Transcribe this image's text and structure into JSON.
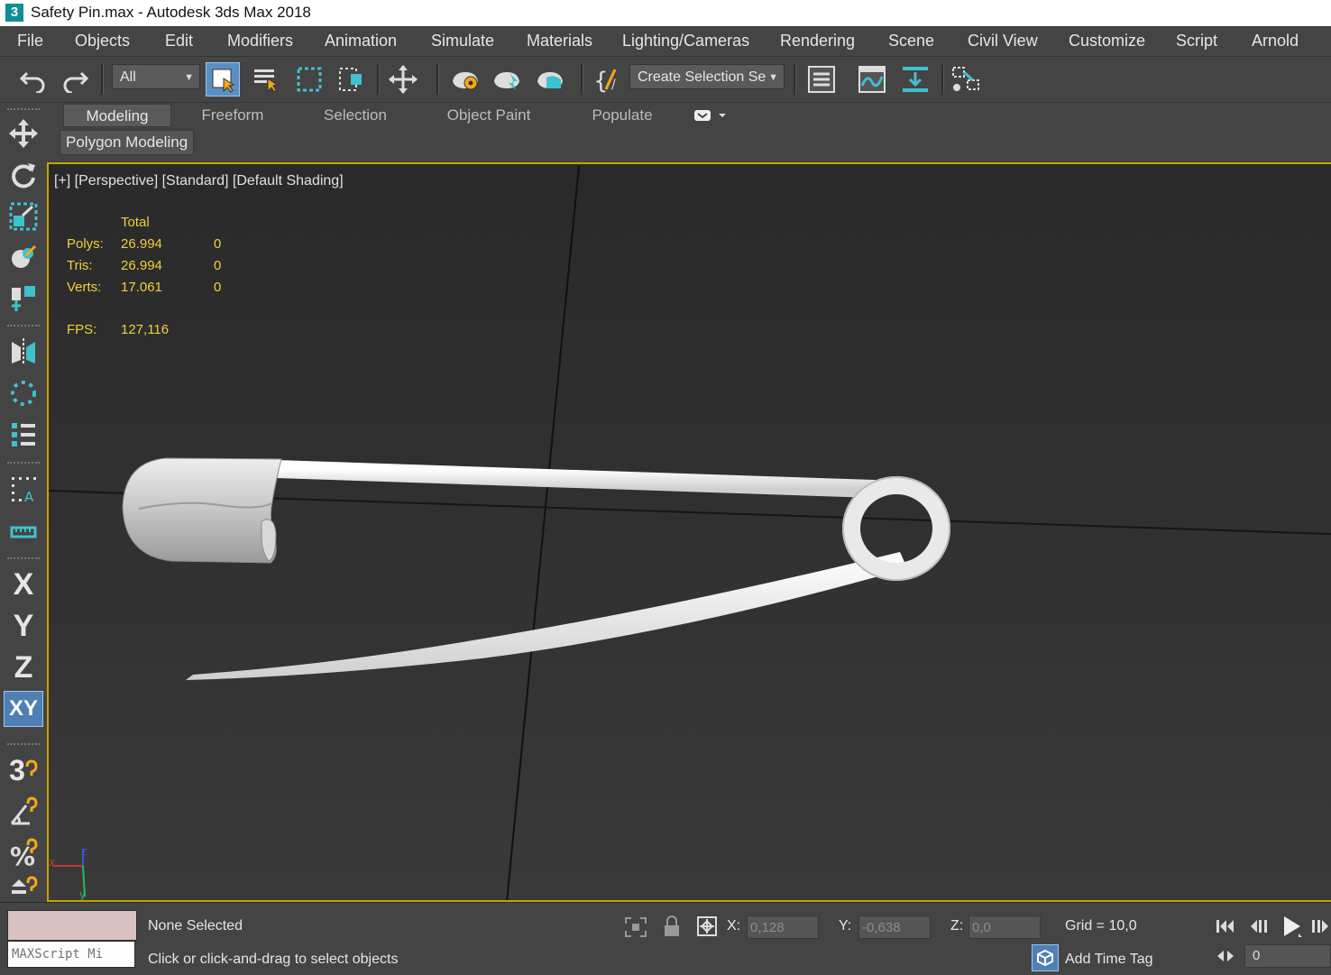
{
  "window": {
    "app_icon_glyph": "3",
    "title": "Safety Pin.max - Autodesk 3ds Max 2018"
  },
  "menu": {
    "items": [
      "File",
      "Objects",
      "Edit",
      "Modifiers",
      "Animation",
      "Simulate",
      "Materials",
      "Lighting/Cameras",
      "Rendering",
      "Scene",
      "Civil View",
      "Customize",
      "Script",
      "Arnold"
    ]
  },
  "toolbar": {
    "selection_filter": "All",
    "named_selection": "Create Selection Se",
    "icons": [
      "undo-icon",
      "redo-icon",
      "select-object-icon",
      "select-by-name-icon",
      "rect-selection-region-icon",
      "window-crossing-icon",
      "select-move-icon",
      "render-setup-icon",
      "render-frame-icon",
      "render-production-icon",
      "edit-named-selections-icon",
      "layer-explorer-icon",
      "curve-editor-icon",
      "material-editor-icon",
      "schematic-view-icon"
    ]
  },
  "ribbon": {
    "tabs": [
      "Modeling",
      "Freeform",
      "Selection",
      "Object Paint",
      "Populate"
    ],
    "active_tab": "Modeling",
    "panel_label": "Polygon Modeling"
  },
  "left_tools": {
    "axis_labels": [
      "X",
      "Y",
      "Z",
      "XY"
    ],
    "snap_labels": [
      "3"
    ],
    "selection_set_glyph": "A"
  },
  "viewport": {
    "label": "[+] [Perspective] [Standard] [Default Shading]",
    "stats": {
      "header": "Total",
      "rows": [
        {
          "label": "Polys:",
          "total": "26.994",
          "selected": "0"
        },
        {
          "label": "Tris:",
          "total": "26.994",
          "selected": "0"
        },
        {
          "label": "Verts:",
          "total": "17.061",
          "selected": "0"
        }
      ],
      "fps_label": "FPS:",
      "fps_value": "127,116"
    },
    "axis_gizmo": {
      "x": "x",
      "y": "y",
      "z": "z"
    },
    "colors": {
      "border_active": "#c8a200",
      "stats_text": "#f2cf3a",
      "object": "#ececec"
    }
  },
  "status": {
    "maxscript_placeholder": "MAXScript Mi",
    "selection_status": "None Selected",
    "prompt": "Click or click-and-drag to select objects",
    "x_label": "X:",
    "x_value": "0,128",
    "y_label": "Y:",
    "y_value": "-0,638",
    "z_label": "Z:",
    "z_value": "0,0",
    "grid": "Grid = 10,0",
    "add_time_tag": "Add Time Tag",
    "frame_value": "0"
  }
}
